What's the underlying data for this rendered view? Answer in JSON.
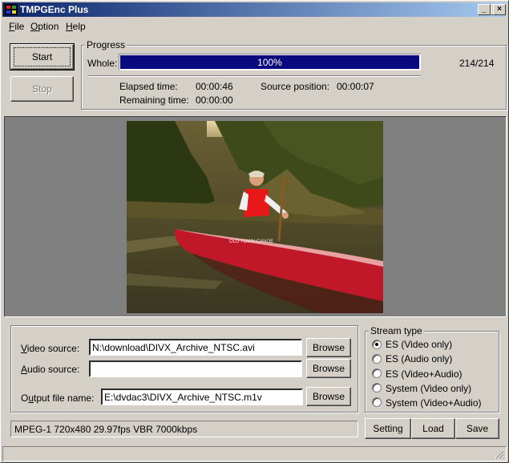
{
  "window": {
    "title": "TMPGEnc Plus",
    "controls": {
      "minimize": "_",
      "maximize": "□",
      "close": "×"
    }
  },
  "menu": [
    {
      "label": "File",
      "mnemonic": "F",
      "rest": "ile"
    },
    {
      "label": "Option",
      "mnemonic": "O",
      "rest": "ption"
    },
    {
      "label": "Help",
      "mnemonic": "H",
      "rest": "elp"
    }
  ],
  "actions": {
    "start": "Start",
    "stop": "Stop"
  },
  "progress": {
    "legend": "Progress",
    "whole_label": "Whole:",
    "percent_text": "100%",
    "fraction": 1.0,
    "frames": "214/214",
    "elapsed_label": "Elapsed time:",
    "elapsed_value": "00:00:46",
    "remaining_label": "Remaining time:",
    "remaining_value": "00:00:00",
    "source_label": "Source position:",
    "source_value": "00:00:07"
  },
  "files": {
    "video_label": "Video source:",
    "video_mnemonic": "V",
    "video_rest": "ideo source:",
    "video_value": "N:\\download\\DIVX_Archive_NTSC.avi",
    "audio_label": "Audio source:",
    "audio_mnemonic": "A",
    "audio_rest": "udio source:",
    "audio_value": "",
    "output_label": "Output file name:",
    "output_pre": "O",
    "output_mnemonic": "u",
    "output_rest": "tput file name:",
    "output_value": "E:\\dvdac3\\DIVX_Archive_NTSC.m1v",
    "browse": "Browse"
  },
  "stream_type": {
    "legend": "Stream type",
    "options": [
      {
        "label": "ES (Video only)",
        "checked": true
      },
      {
        "label": "ES (Audio only)",
        "checked": false
      },
      {
        "label": "ES (Video+Audio)",
        "checked": false
      },
      {
        "label": "System (Video only)",
        "checked": false
      },
      {
        "label": "System (Video+Audio)",
        "checked": false
      }
    ]
  },
  "encode_summary": "MPEG-1 720x480 29.97fps VBR 7000kbps",
  "bottom_buttons": {
    "setting": "Setting",
    "load": "Load",
    "save": "Save"
  },
  "colors": {
    "titlebar_start": "#0a246a",
    "titlebar_end": "#a6caf0",
    "progress_fill": "#0a0a80",
    "face": "#d4d0c8"
  }
}
